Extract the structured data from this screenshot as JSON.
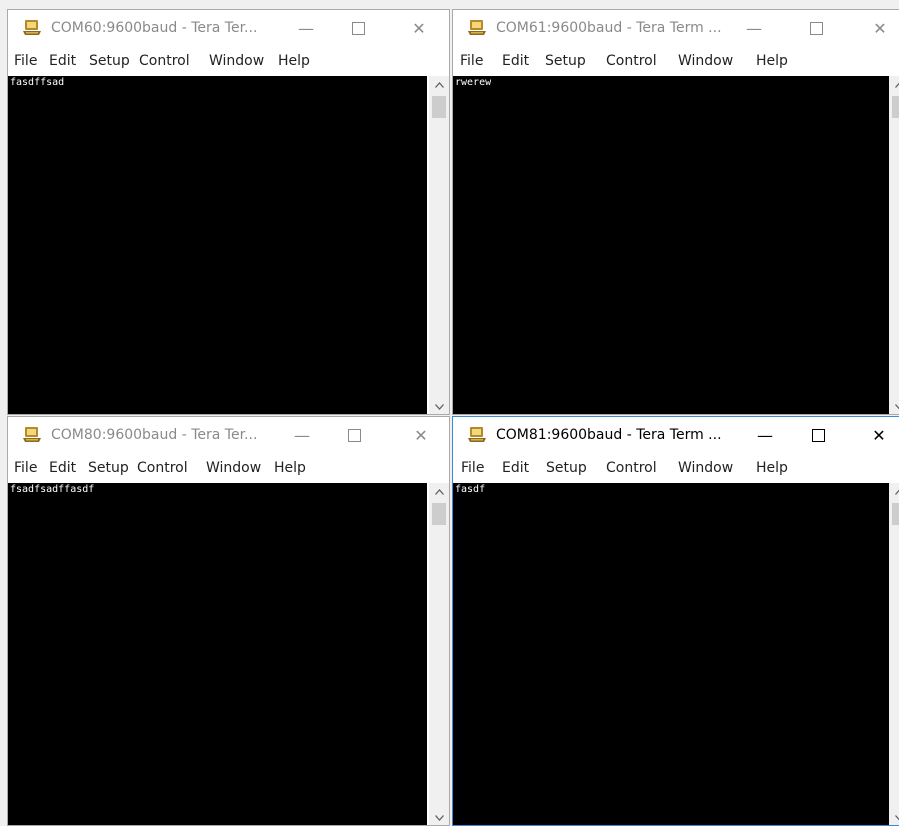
{
  "menu": [
    "File",
    "Edit",
    "Setup",
    "Control",
    "Window",
    "Help"
  ],
  "controls": {
    "minimize": "—",
    "close": "✕"
  },
  "icons": {
    "app": "tera-term-app-icon",
    "scroll_up": "chevron-up-icon",
    "scroll_down": "chevron-down-icon"
  },
  "colors": {
    "terminal_bg": "#000000",
    "terminal_fg": "#ffffff",
    "active_border": "#3a8ad6",
    "inactive_title": "#8a8a8a"
  },
  "windows": [
    {
      "title": "COM60:9600baud - Tera Ter...",
      "terminal_text": "fasdffsad",
      "active": false
    },
    {
      "title": "COM61:9600baud - Tera Term ...",
      "terminal_text": "rwerew",
      "active": false
    },
    {
      "title": "COM80:9600baud - Tera Ter...",
      "terminal_text": "fsadfsadffasdf",
      "active": false
    },
    {
      "title": "COM81:9600baud - Tera Term ...",
      "terminal_text": "fasdf",
      "active": true
    }
  ]
}
